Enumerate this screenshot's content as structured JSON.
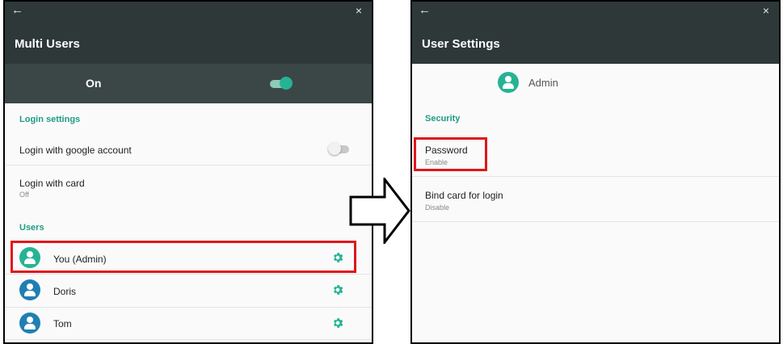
{
  "left": {
    "title": "Multi Users",
    "back_icon": "←",
    "close_icon": "×",
    "on_label": "On",
    "login_settings_header": "Login settings",
    "login_google": "Login with google account",
    "login_card": "Login with card",
    "login_card_status": "Off",
    "users_header": "Users",
    "users": [
      {
        "name": "You (Admin)",
        "avatar_color": "#26b394"
      },
      {
        "name": "Doris",
        "avatar_color": "#1f7fb3"
      },
      {
        "name": "Tom",
        "avatar_color": "#1f7fb3"
      }
    ]
  },
  "right": {
    "title": "User Settings",
    "back_icon": "←",
    "close_icon": "×",
    "user_name": "Admin",
    "security_header": "Security",
    "password_label": "Password",
    "password_status": "Enable",
    "bind_card_label": "Bind card for login",
    "bind_card_status": "Disable"
  },
  "colors": {
    "accent": "#26b394",
    "highlight": "#e0161b",
    "appbar": "#2e3838",
    "header_text": "#1e9c86"
  }
}
